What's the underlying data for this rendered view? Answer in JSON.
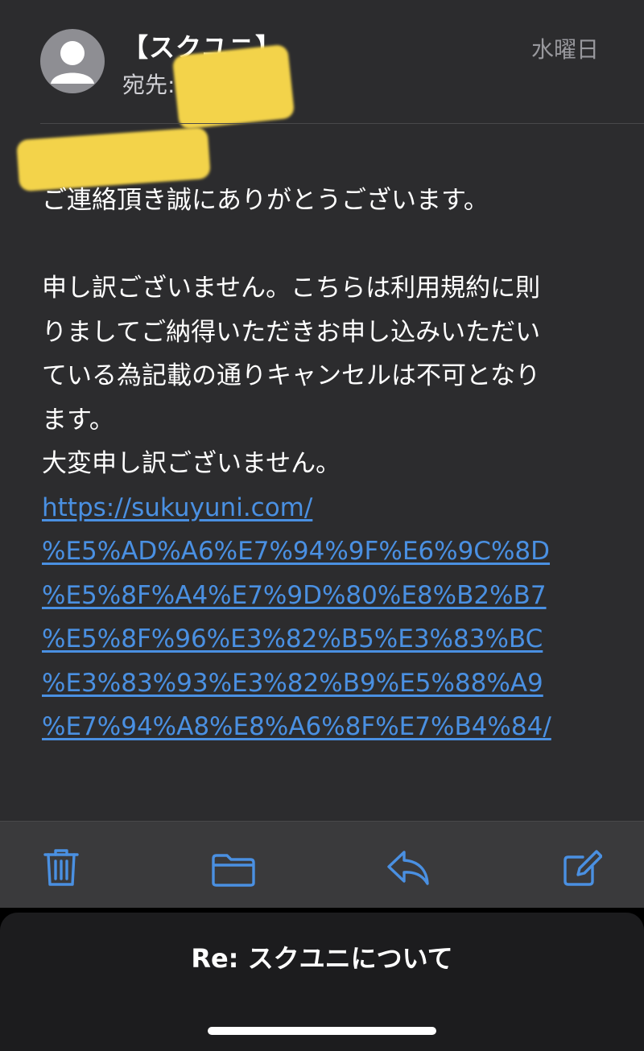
{
  "header": {
    "sender": "【スクユニ】",
    "to_label": "宛先:",
    "to_value": "",
    "date": "水曜日"
  },
  "body": {
    "salutation": "",
    "paragraphs": [
      "ご連絡頂き誠にありがとうございます。",
      "",
      "申し訳ございません。こちらは利用規約に則",
      "りましてご納得いただきお申し込みいただい",
      "ている為記載の通りキャンセルは不可となり",
      "ます。",
      "大変申し訳ございません。"
    ],
    "link_lines": [
      "https://sukuyuni.com/",
      "%E5%AD%A6%E7%94%9F%E6%9C%8D",
      "%E5%8F%A4%E7%9D%80%E8%B2%B7",
      "%E5%8F%96%E3%82%B5%E3%83%BC",
      "%E3%83%93%E3%82%B9%E5%88%A9",
      "%E7%94%A8%E8%A6%8F%E7%B4%84/"
    ]
  },
  "toolbar": {
    "icons": [
      "trash-icon",
      "folder-icon",
      "reply-icon",
      "compose-icon"
    ],
    "accent": "#4a90e2"
  },
  "reply_sheet": {
    "title": "Re: スクユニについて"
  }
}
